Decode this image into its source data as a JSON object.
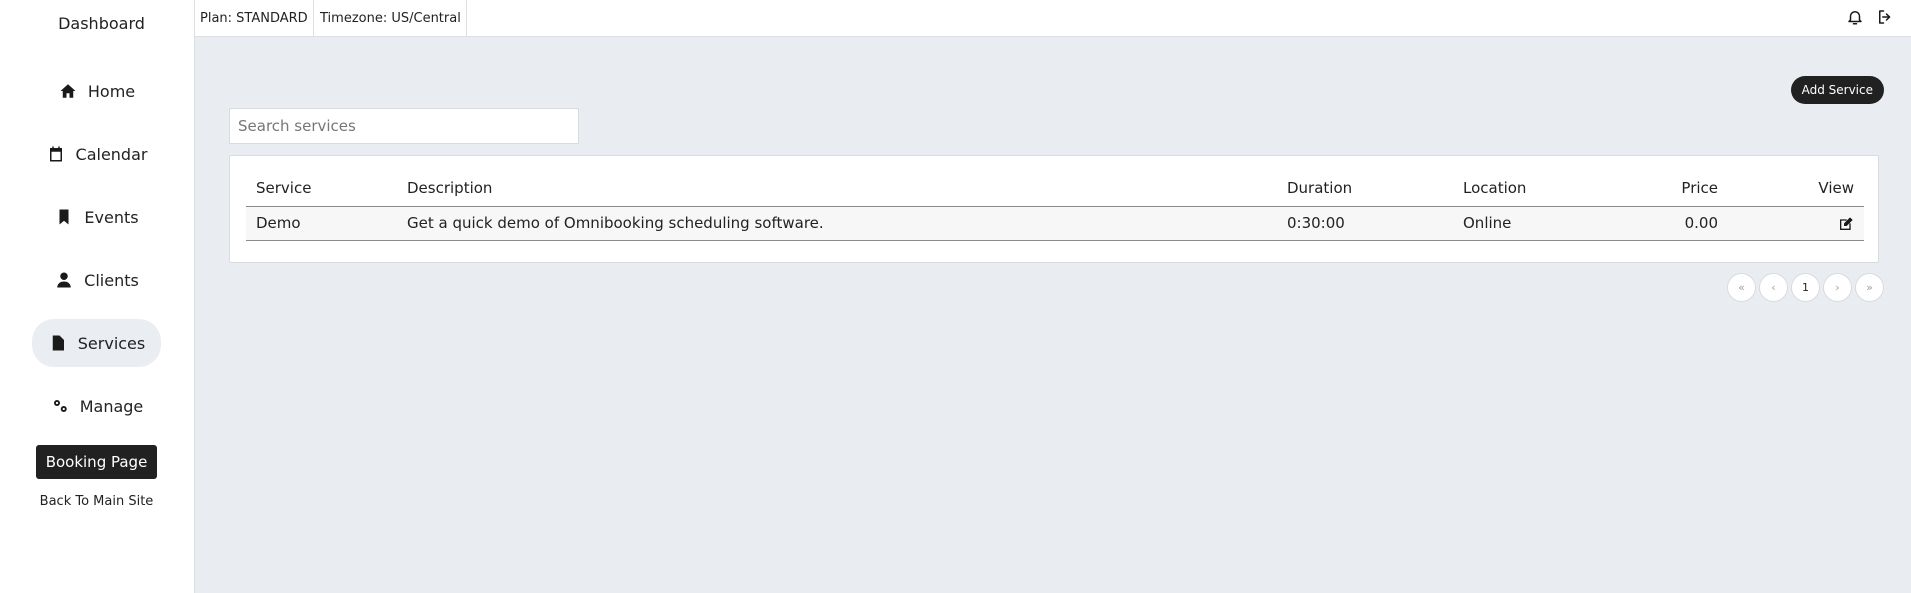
{
  "sidebar": {
    "title": "Dashboard",
    "items": [
      {
        "label": "Home",
        "icon": "home-icon"
      },
      {
        "label": "Calendar",
        "icon": "calendar-icon"
      },
      {
        "label": "Events",
        "icon": "bookmark-icon"
      },
      {
        "label": "Clients",
        "icon": "user-icon"
      },
      {
        "label": "Services",
        "icon": "file-icon",
        "active": true
      },
      {
        "label": "Manage",
        "icon": "gears-icon"
      }
    ],
    "booking_page": "Booking Page",
    "back_link": "Back To Main Site"
  },
  "topbar": {
    "plan": "Plan: STANDARD",
    "timezone": "Timezone: US/Central"
  },
  "main": {
    "add_service": "Add Service",
    "search_placeholder": "Search services",
    "table": {
      "headers": [
        "Service",
        "Description",
        "Duration",
        "Location",
        "Price",
        "View"
      ],
      "rows": [
        {
          "service": "Demo",
          "description": "Get a quick demo of Omnibooking scheduling software.",
          "duration": "0:30:00",
          "location": "Online",
          "price": "0.00"
        }
      ]
    },
    "pagination": {
      "first": "«",
      "prev": "‹",
      "current": "1",
      "next": "›",
      "last": "»"
    }
  },
  "colors": {
    "accent_dark": "#212121",
    "main_bg": "#e9ecf1",
    "active_bg": "#eaedf1"
  }
}
